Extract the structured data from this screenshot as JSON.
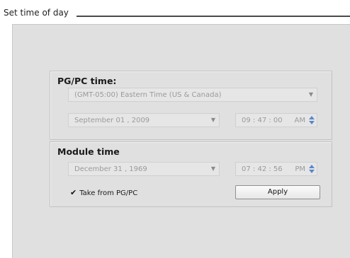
{
  "group": {
    "title": "Set time of day"
  },
  "pgpc": {
    "title": "PG/PC time:",
    "timezone": "(GMT-05:00) Eastern Time (US & Canada)",
    "date": "September 01 ,  2009",
    "time": "09 : 47 : 00",
    "ampm": "AM"
  },
  "module": {
    "title": "Module time",
    "date": "December 31 ,  1969",
    "time": "07 : 42 : 56",
    "ampm": "PM",
    "take_from_label": "Take from PG/PC",
    "take_from_checked": true,
    "apply_label": "Apply"
  },
  "icons": {
    "dropdown": "chevron-down-icon",
    "spinner": "spinner-arrows-icon",
    "check": "checkmark-icon"
  },
  "colors": {
    "panel_bg": "#e0e0e0",
    "spinner_accent": "#5b86c9"
  }
}
